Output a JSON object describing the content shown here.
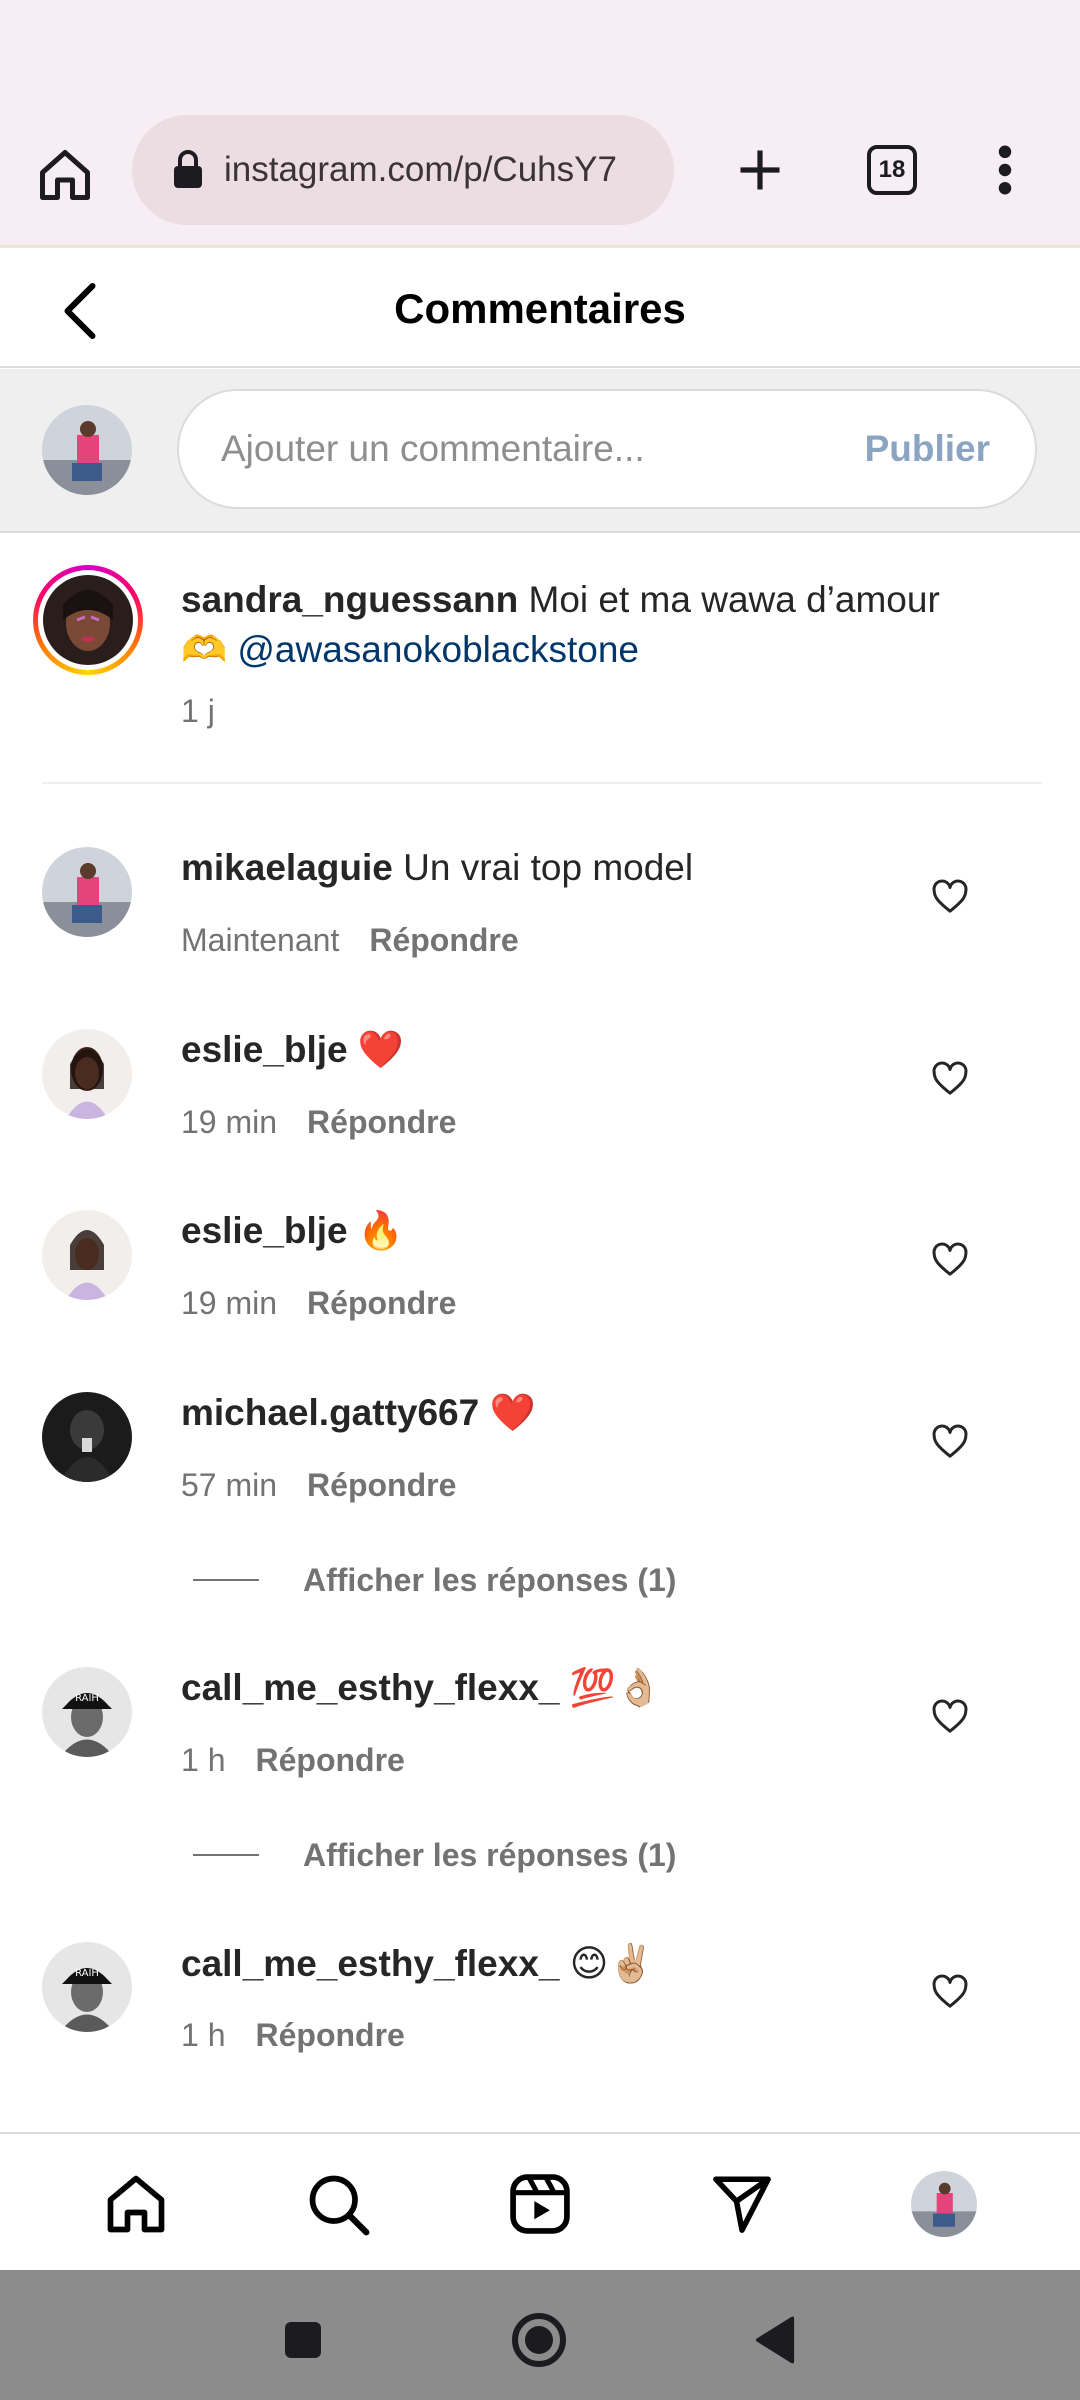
{
  "browser": {
    "url": "instagram.com/p/CuhsY7",
    "tab_count": "18"
  },
  "header": {
    "title": "Commentaires"
  },
  "compose": {
    "placeholder": "Ajouter un commentaire...",
    "publish_label": "Publier"
  },
  "caption": {
    "username": "sandra_nguessann",
    "text": "Moi et ma wawa d’amour",
    "emoji": "🫶",
    "mention": "@awasanokoblackstone",
    "time": "1 j"
  },
  "comments": [
    {
      "username": "mikaelaguie",
      "text": "Un vrai top model",
      "time": "Maintenant",
      "reply_label": "Répondre"
    },
    {
      "username": "eslie_blje",
      "text": "❤️",
      "time": "19 min",
      "reply_label": "Répondre"
    },
    {
      "username": "eslie_blje",
      "text": "🔥",
      "time": "19 min",
      "reply_label": "Répondre"
    },
    {
      "username": "michael.gatty667",
      "text": "❤️",
      "time": "57 min",
      "reply_label": "Répondre"
    },
    {
      "username": "call_me_esthy_flexx_",
      "text": "💯👌🏼",
      "time": "1 h",
      "reply_label": "Répondre"
    },
    {
      "username": "call_me_esthy_flexx_",
      "text": "😊✌🏼",
      "time": "1 h",
      "reply_label": "Répondre"
    }
  ],
  "view_replies": [
    {
      "label": "Afficher les réponses (1)"
    },
    {
      "label": "Afficher les réponses (1)"
    }
  ],
  "colors": {
    "chrome_bg": "#f7eef3",
    "url_pill": "#ecdde2",
    "compose_bg": "#efefef",
    "mention": "#00376b",
    "publish": "#8aa4c2",
    "meta_text": "#737373",
    "system_nav": "#8c8c8c"
  }
}
